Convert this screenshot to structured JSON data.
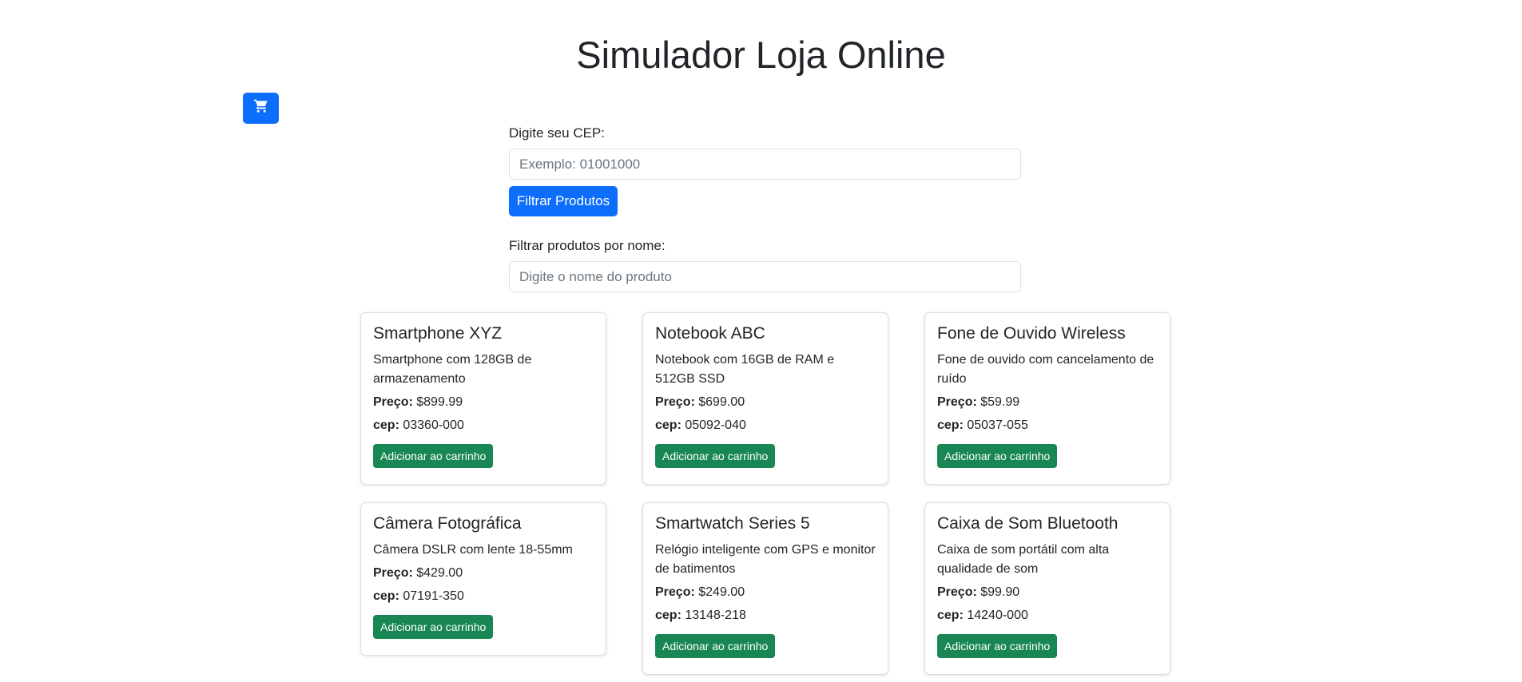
{
  "page": {
    "title": "Simulador Loja Online"
  },
  "cart": {
    "icon": "cart-icon",
    "color": "#0d6efd"
  },
  "cep_filter": {
    "label": "Digite seu CEP:",
    "placeholder": "Exemplo: 01001000",
    "button_label": "Filtrar Produtos"
  },
  "name_filter": {
    "label": "Filtrar produtos por nome:",
    "placeholder": "Digite o nome do produto"
  },
  "labels": {
    "price": "Preço:",
    "cep": "cep:",
    "add_to_cart": "Adicionar ao carrinho"
  },
  "products": [
    {
      "name": "Smartphone XYZ",
      "description": "Smartphone com 128GB de armazenamento",
      "price": "$899.99",
      "cep": "03360-000"
    },
    {
      "name": "Notebook ABC",
      "description": "Notebook com 16GB de RAM e 512GB SSD",
      "price": "$699.00",
      "cep": "05092-040"
    },
    {
      "name": "Fone de Ouvido Wireless",
      "description": "Fone de ouvido com cancelamento de ruído",
      "price": "$59.99",
      "cep": "05037-055"
    },
    {
      "name": "Câmera Fotográfica",
      "description": "Câmera DSLR com lente 18-55mm",
      "price": "$429.00",
      "cep": "07191-350"
    },
    {
      "name": "Smartwatch Series 5",
      "description": "Relógio inteligente com GPS e monitor de batimentos",
      "price": "$249.00",
      "cep": "13148-218"
    },
    {
      "name": "Caixa de Som Bluetooth",
      "description": "Caixa de som portátil com alta qualidade de som",
      "price": "$99.90",
      "cep": "14240-000"
    }
  ],
  "colors": {
    "primary": "#0d6efd",
    "success": "#198754",
    "text": "#212529"
  }
}
